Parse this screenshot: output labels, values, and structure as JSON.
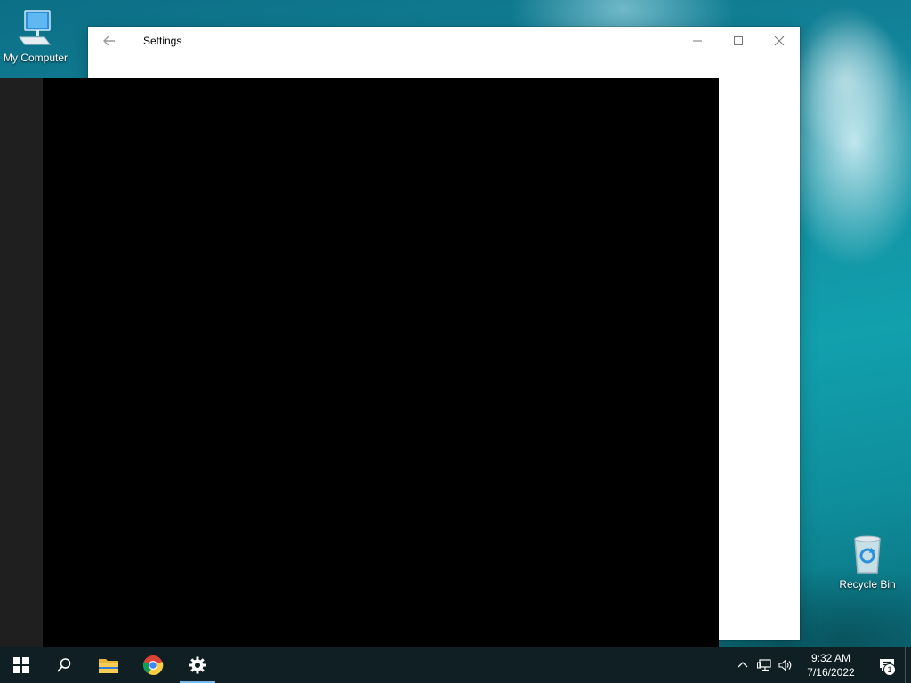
{
  "desktop": {
    "icons": [
      {
        "label": "My Computer",
        "icon": "computer-icon"
      },
      {
        "label": "Recycle Bin",
        "icon": "recycle-bin-icon"
      }
    ]
  },
  "window": {
    "title": "Settings",
    "back_icon": "back-arrow-icon",
    "controls": [
      "minimize-icon",
      "maximize-icon",
      "close-icon"
    ]
  },
  "taskbar": {
    "apps": [
      {
        "name": "start",
        "icon": "windows-logo-icon"
      },
      {
        "name": "search",
        "icon": "search-icon"
      },
      {
        "name": "file-explorer",
        "icon": "folder-icon"
      },
      {
        "name": "chrome",
        "icon": "chrome-icon"
      },
      {
        "name": "settings",
        "icon": "gear-icon",
        "active": true
      }
    ],
    "tray": {
      "icons": [
        "chevron-up-icon",
        "network-icon",
        "volume-icon"
      ],
      "time": "9:32 AM",
      "date": "7/16/2022",
      "notification_count": "1"
    }
  },
  "colors": {
    "taskbar": "#0f1f24",
    "active_indicator": "#76b9ed",
    "window_bg": "#ffffff",
    "overlay": "#000000"
  }
}
